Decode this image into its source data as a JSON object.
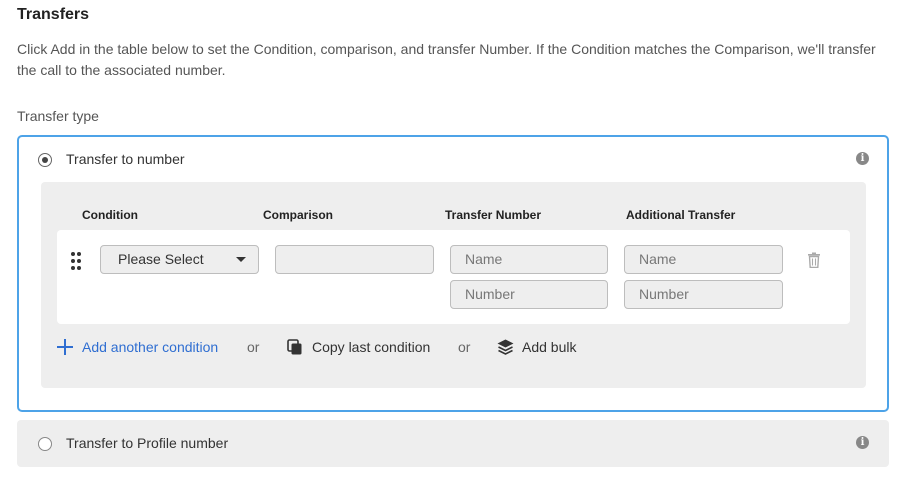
{
  "header": {
    "title": "Transfers",
    "description": "Click Add in the table below to set the Condition, comparison, and transfer Number. If the Condition matches the Comparison, we'll transfer the call to the associated number."
  },
  "transfer_type": {
    "label": "Transfer type",
    "options": [
      {
        "label": "Transfer to number",
        "selected": true
      },
      {
        "label": "Transfer to Profile number",
        "selected": false
      }
    ]
  },
  "table": {
    "columns": [
      "Condition",
      "Comparison",
      "Transfer Number",
      "Additional Transfer"
    ],
    "rows": [
      {
        "condition": "Please Select",
        "comparison": "",
        "transfer_number": {
          "name_placeholder": "Name",
          "number_placeholder": "Number"
        },
        "additional_transfer": {
          "name_placeholder": "Name",
          "number_placeholder": "Number"
        }
      }
    ]
  },
  "actions": {
    "add_condition": "Add another condition",
    "or_1": "or",
    "copy_last": "Copy last condition",
    "or_2": "or",
    "add_bulk": "Add bulk"
  },
  "icons": {
    "info": "info-icon",
    "drag": "drag-handle-icon",
    "trash": "trash-icon",
    "copy": "copy-icon",
    "layers": "layers-icon",
    "plus": "plus-icon"
  },
  "colors": {
    "accent": "#2f6ed1",
    "selected_border": "#4da3e8",
    "panel_bg": "#eeeeee"
  }
}
